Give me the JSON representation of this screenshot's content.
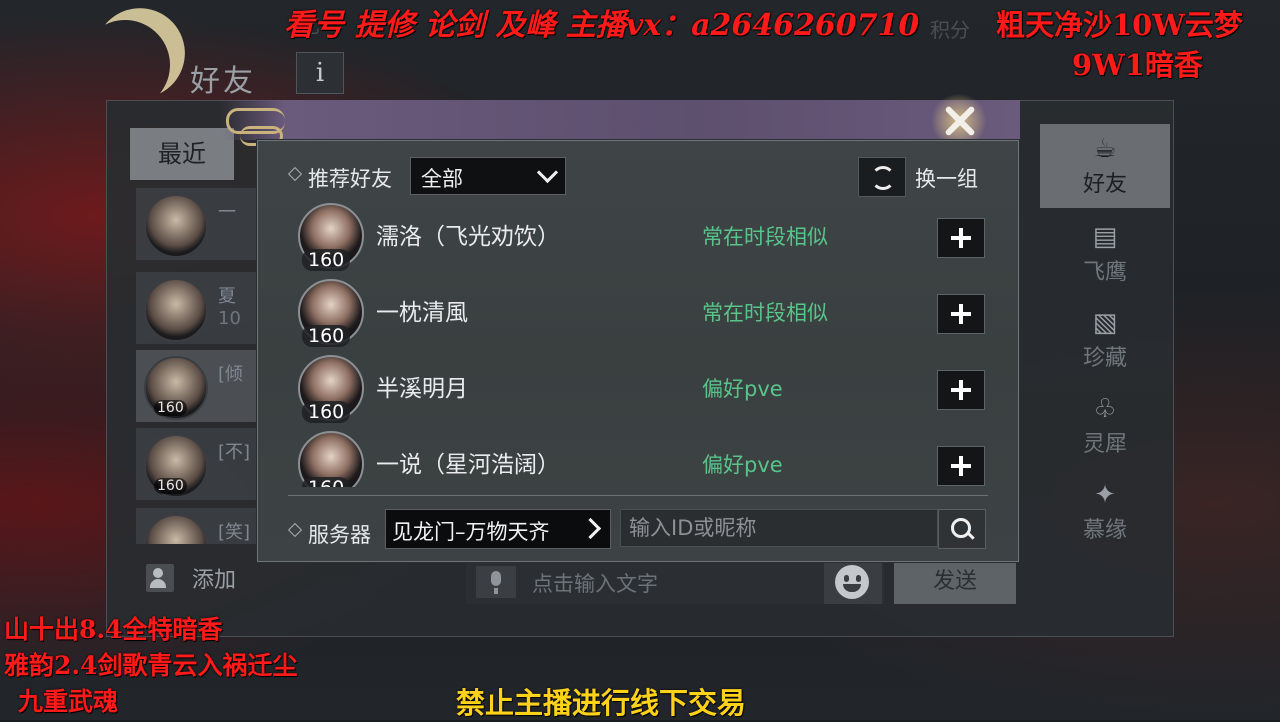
{
  "background": {
    "hud_left": "亿",
    "hud_right": "积分"
  },
  "friend_panel": {
    "title": "好友",
    "info_icon_glyph": "i",
    "tab_recent": "最近",
    "list": [
      {
        "name": "一",
        "sub": "",
        "level": ""
      },
      {
        "name": "夏",
        "sub": "10",
        "level": ""
      },
      {
        "name": "[倾",
        "sub": "",
        "level": "160"
      },
      {
        "name": "[不]",
        "sub": "",
        "level": "160"
      },
      {
        "name": "[笑]",
        "sub": "",
        "level": ""
      }
    ],
    "add_label": "添加",
    "chat_placeholder": "点击输入文字",
    "send_label": "发送"
  },
  "side_nav": [
    {
      "label": "好友",
      "icon": "teapot-icon",
      "glyph": "☕",
      "active": true
    },
    {
      "label": "飞鹰",
      "icon": "scroll-icon",
      "glyph": "▤",
      "active": false
    },
    {
      "label": "珍藏",
      "icon": "collection-icon",
      "glyph": "▧",
      "active": false
    },
    {
      "label": "灵犀",
      "icon": "bell-icon",
      "glyph": "♧",
      "active": false
    },
    {
      "label": "慕缘",
      "icon": "crane-icon",
      "glyph": "✦",
      "active": false
    }
  ],
  "dialog": {
    "recommend_label": "推荐好友",
    "filter_value": "全部",
    "refresh_label": "换一组",
    "recommendations": [
      {
        "name": "濡洛（飞光劝饮）",
        "level": "160",
        "tag": "常在时段相似"
      },
      {
        "name": "一枕清風",
        "level": "160",
        "tag": "常在时段相似"
      },
      {
        "name": "半溪明月",
        "level": "160",
        "tag": "偏好pve"
      },
      {
        "name": "一说（星河浩阔）",
        "level": "160",
        "tag": "偏好pve"
      }
    ],
    "server_label": "服务器",
    "server_value": "见龙门–万物天齐",
    "search_placeholder": "输入ID或昵称"
  },
  "overlays": {
    "top": "看号 提修 论剑 及峰 主播vx：a2646260710",
    "top_right_1": "粗天净沙10W云梦",
    "top_right_2": "9W1暗香",
    "bottom_left_1": "山十出8.4全特暗香",
    "bottom_left_2": "雅韵2.4剑歌青云入祸迁尘",
    "bottom_left_3": "九重武魂",
    "bottom": "禁止主播进行线下交易"
  },
  "colors": {
    "tag_green": "#58c48a",
    "overlay_red": "#ff1a1a",
    "overlay_yellow": "#ffd21a"
  }
}
